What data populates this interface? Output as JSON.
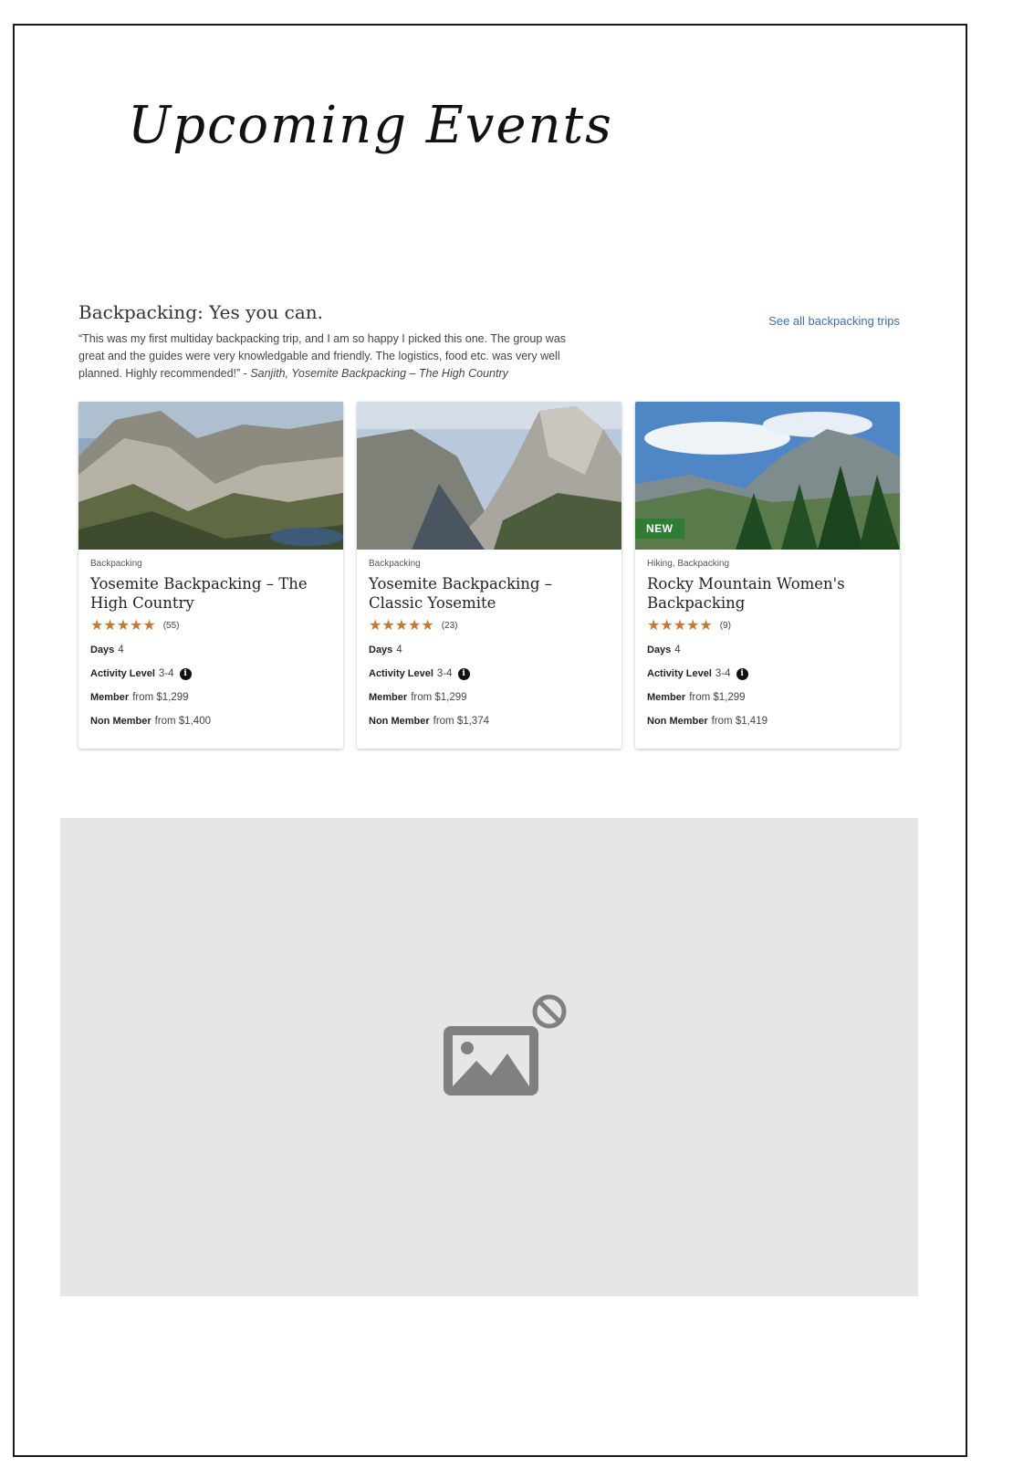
{
  "page": {
    "title": "Upcoming Events"
  },
  "section": {
    "heading": "Backpacking: Yes you can.",
    "see_all": "See all backpacking trips",
    "quote": "“This was my first multiday backpacking trip, and I am so happy I picked this one. The group was great and the guides were very knowledgable and friendly. The logistics, food etc. was very well planned. Highly recommended!” -",
    "attribution": "Sanjith, Yosemite Backpacking – The High Country"
  },
  "labels": {
    "days": "Days",
    "activity": "Activity Level",
    "member": "Member",
    "non_member": "Non Member"
  },
  "cards": [
    {
      "category": "Backpacking",
      "title": "Yosemite Backpacking – The High Country",
      "stars": "★★★★★",
      "rating": 5,
      "reviews": "(55)",
      "days": "4",
      "activity": "3-4",
      "member_price": "from $1,299",
      "non_member_price": "from $1,400",
      "badge": ""
    },
    {
      "category": "Backpacking",
      "title": "Yosemite Backpacking – Classic Yosemite",
      "stars": "★★★★★",
      "rating": 5,
      "reviews": "(23)",
      "days": "4",
      "activity": "3-4",
      "member_price": "from $1,299",
      "non_member_price": "from $1,374",
      "badge": ""
    },
    {
      "category": "Hiking, Backpacking",
      "title": "Rocky Mountain Women's Backpacking",
      "stars": "★★★★★",
      "rating": 5,
      "reviews": "(9)",
      "days": "4",
      "activity": "3-4",
      "member_price": "from $1,299",
      "non_member_price": "from $1,419",
      "badge": "NEW"
    }
  ],
  "icons": {
    "info": "info-icon",
    "placeholder": "broken-image-icon",
    "blocked": "blocked-icon"
  },
  "colors": {
    "link": "#3a6fb5",
    "stars": "#c8782a",
    "badge": "#2e7d32",
    "placeholder_bg": "#e6e6e6"
  }
}
